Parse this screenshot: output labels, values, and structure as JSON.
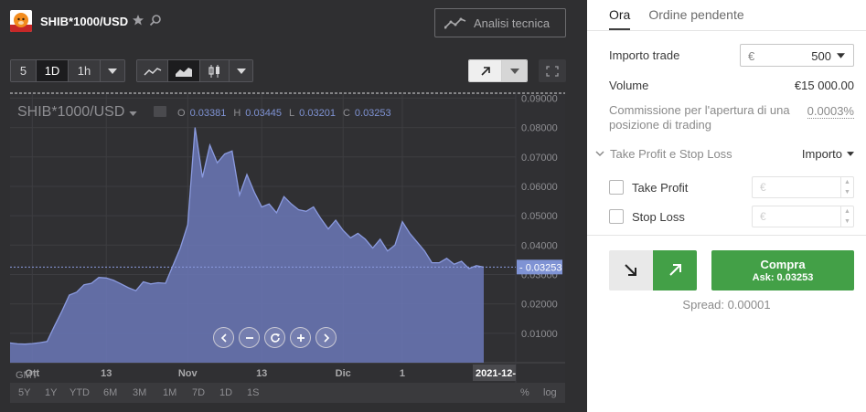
{
  "header": {
    "symbol": "SHIB*1000/USD",
    "technical_analysis_label": "Analisi tecnica"
  },
  "toolbar": {
    "intervals": [
      "5",
      "1D",
      "1h"
    ],
    "active_interval": "1D"
  },
  "chart_header": {
    "symbol": "SHIB*1000/USD",
    "ohlc": [
      {
        "label": "O",
        "value": "0.03381"
      },
      {
        "label": "H",
        "value": "0.03445"
      },
      {
        "label": "L",
        "value": "0.03201"
      },
      {
        "label": "C",
        "value": "0.03253"
      }
    ]
  },
  "chart_data": {
    "type": "area",
    "x_tick_labels": [
      "Ott",
      "13",
      "Nov",
      "13",
      "Dic",
      "1"
    ],
    "y_tick_labels": [
      "0.09000",
      "0.08000",
      "0.07000",
      "0.06000",
      "0.05000",
      "0.04000",
      "0.03000",
      "0.02000",
      "0.01000"
    ],
    "ylim": [
      0,
      0.092
    ],
    "current_price_label": "0.03253",
    "current_price": 0.03253,
    "crosshair_date_label": "2021-12-",
    "timezone_label": "GMT",
    "grid": true,
    "values": [
      0.0067,
      0.0064,
      0.0063,
      0.0065,
      0.0068,
      0.0072,
      0.0125,
      0.0175,
      0.023,
      0.024,
      0.0265,
      0.027,
      0.029,
      0.0288,
      0.028,
      0.0268,
      0.0255,
      0.0245,
      0.0275,
      0.0268,
      0.0272,
      0.027,
      0.033,
      0.039,
      0.047,
      0.08,
      0.063,
      0.074,
      0.068,
      0.071,
      0.072,
      0.057,
      0.064,
      0.058,
      0.053,
      0.054,
      0.051,
      0.0565,
      0.054,
      0.052,
      0.0515,
      0.053,
      0.049,
      0.0455,
      0.0485,
      0.045,
      0.0425,
      0.044,
      0.042,
      0.039,
      0.042,
      0.038,
      0.04,
      0.048,
      0.044,
      0.041,
      0.038,
      0.034,
      0.034,
      0.0355,
      0.0335,
      0.0345,
      0.032,
      0.033,
      0.0325
    ]
  },
  "range_selector": [
    "5Y",
    "1Y",
    "YTD",
    "6M",
    "3M",
    "1M",
    "7D",
    "1D",
    "1S"
  ],
  "range_right": [
    "%",
    "log"
  ],
  "order_panel": {
    "tabs": [
      "Ora",
      "Ordine pendente"
    ],
    "active_tab": "Ora",
    "amount_label": "Importo trade",
    "amount_currency": "€",
    "amount_value": "500",
    "volume_label": "Volume",
    "volume_value": "€15 000.00",
    "commission_label": "Commissione per l'apertura di una posizione di trading",
    "commission_value": "0.0003%",
    "tpsl_label": "Take Profit e Stop Loss",
    "tpsl_mode": "Importo",
    "take_profit_label": "Take Profit",
    "stop_loss_label": "Stop Loss",
    "tp_placeholder": "€",
    "sl_placeholder": "€",
    "buy_label": "Compra",
    "buy_ask": "Ask: 0.03253",
    "spread": "Spread: 0.00001"
  },
  "colors": {
    "chart_fill": "#6b78b8",
    "chart_line": "#8b9be0",
    "buy_green": "#43a047",
    "panel_dark": "#2f2f31"
  }
}
